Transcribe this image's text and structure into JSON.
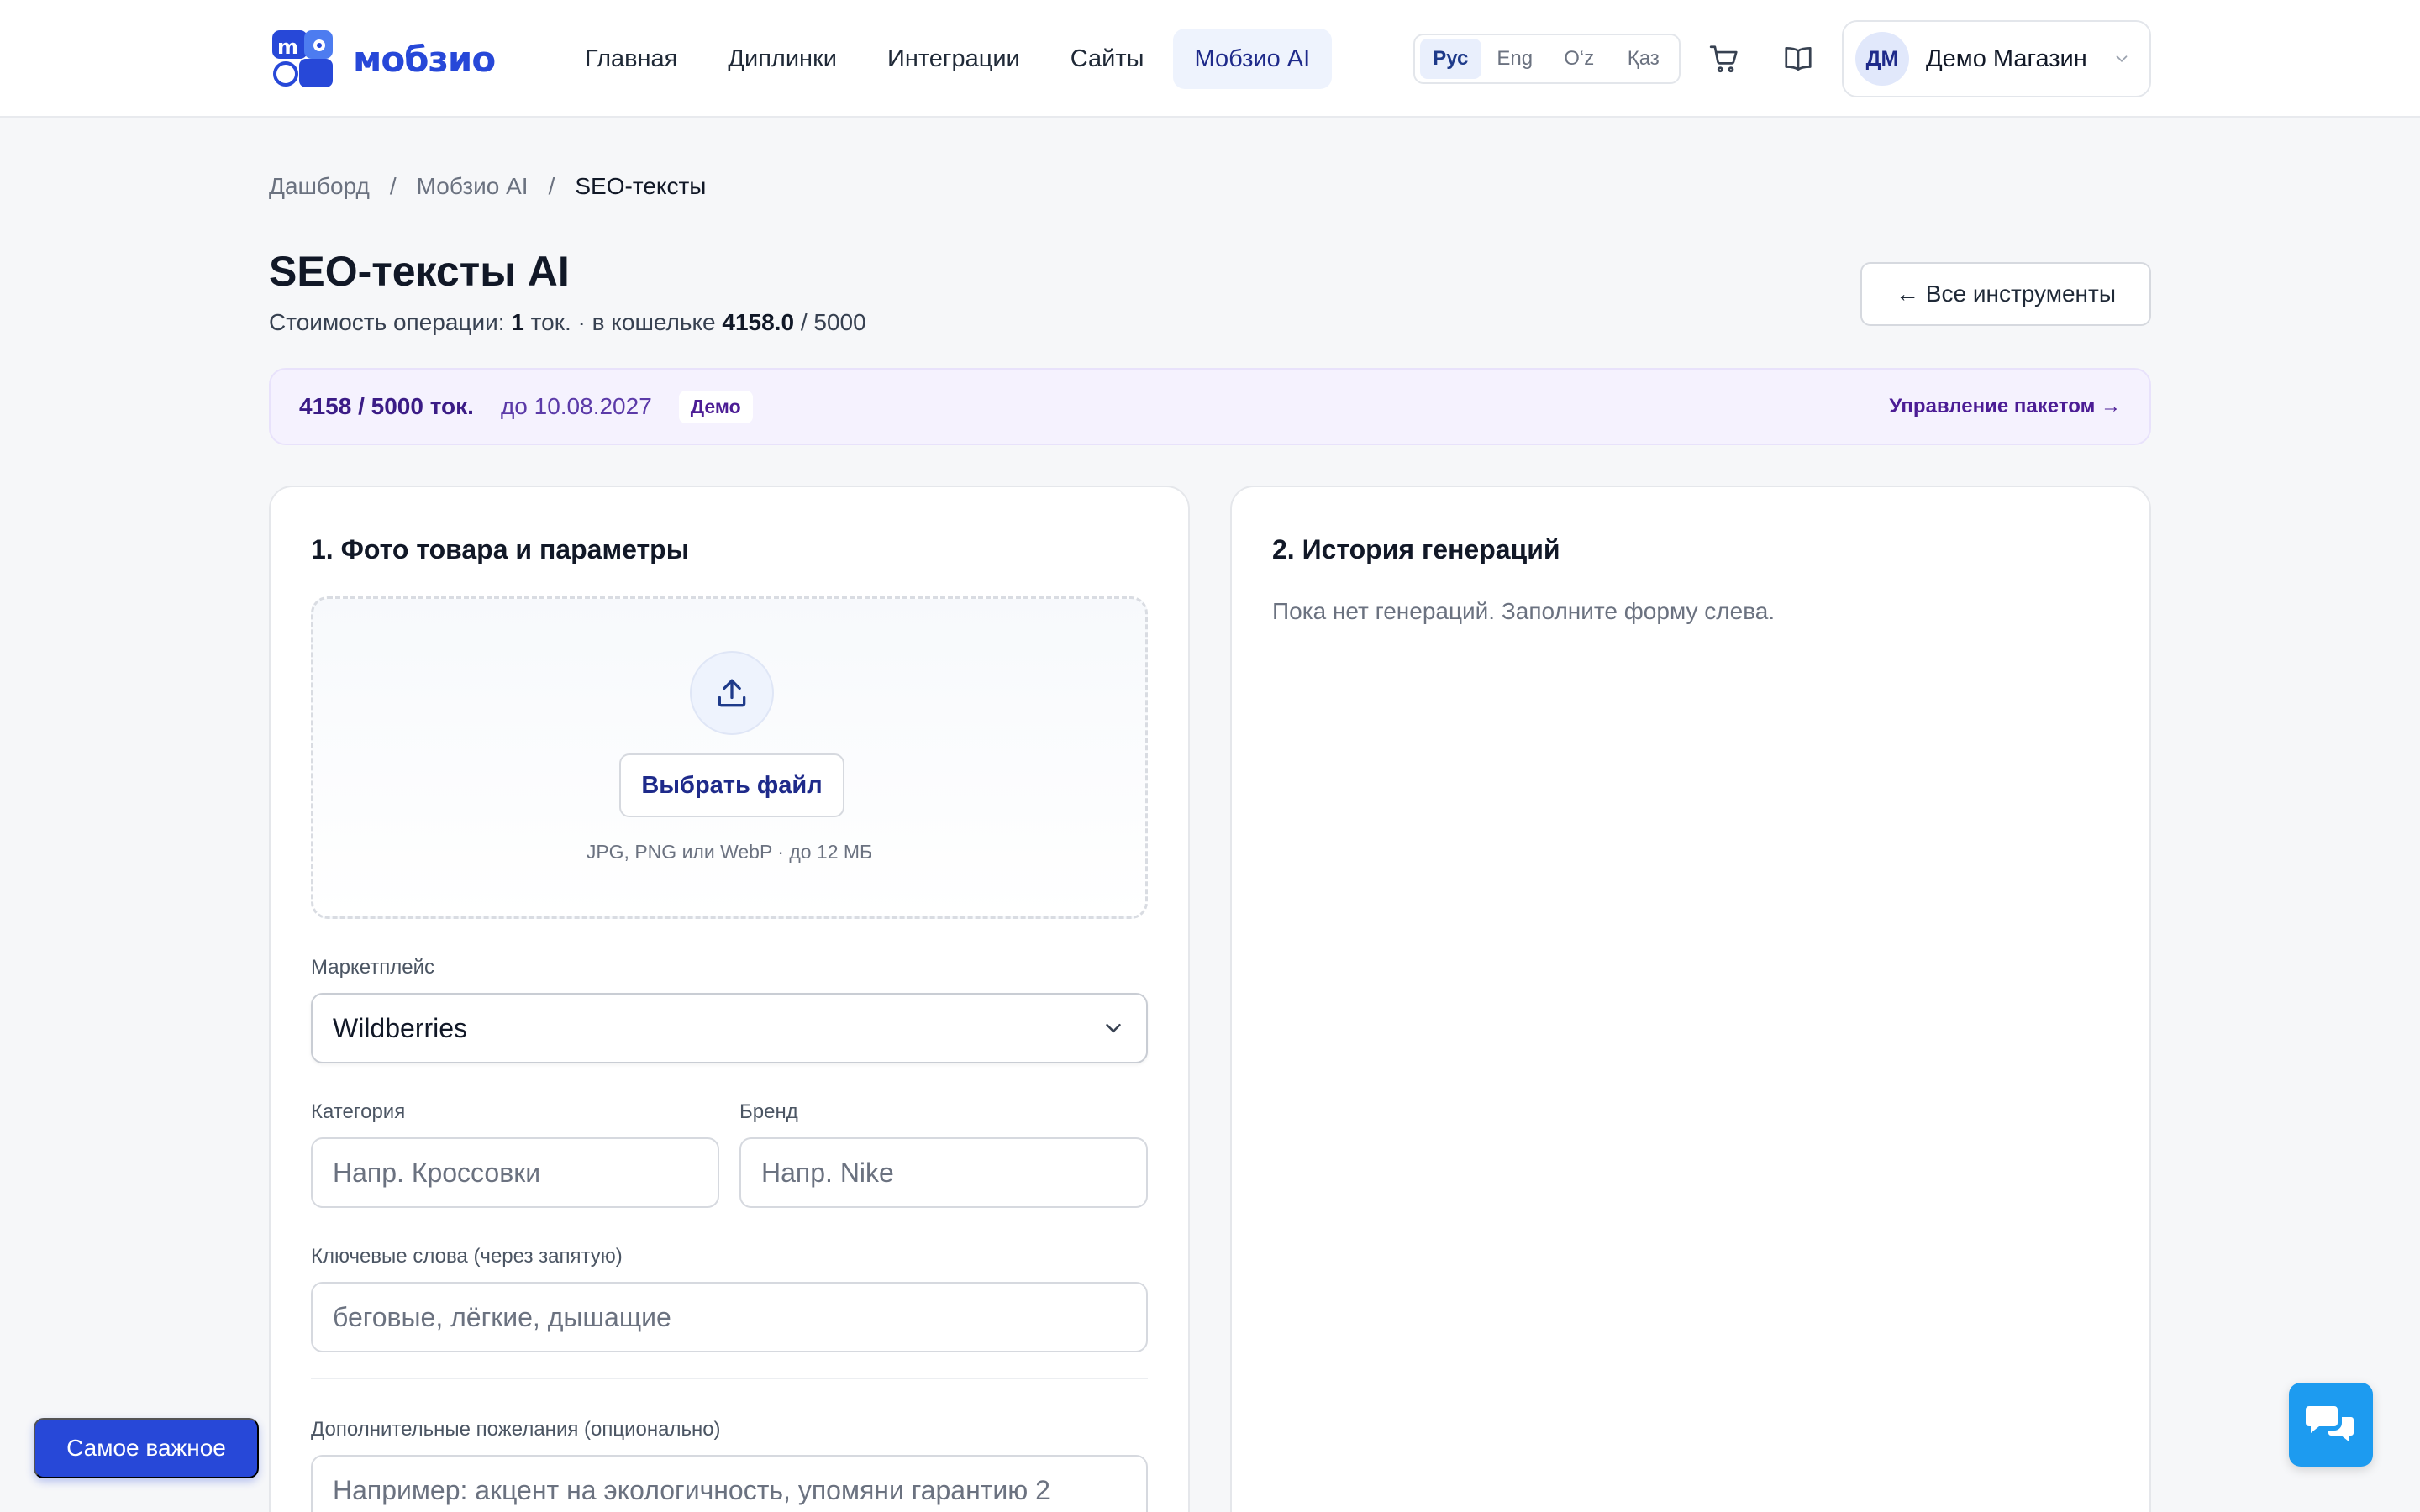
{
  "header": {
    "logo_text": "мобзио",
    "nav": [
      {
        "label": "Главная"
      },
      {
        "label": "Диплинки"
      },
      {
        "label": "Интеграции"
      },
      {
        "label": "Сайты"
      },
      {
        "label": "Мобзио AI",
        "active": true
      }
    ],
    "languages": [
      "Рус",
      "Eng",
      "O‘z",
      "Қаз"
    ],
    "active_language": "Рус",
    "icons": [
      "cart-icon",
      "book-icon",
      "chevron-down-icon"
    ],
    "user": {
      "initials": "ДМ",
      "name": "Демо Магазин"
    }
  },
  "breadcrumb": [
    "Дашборд",
    "Мобзио AI",
    "SEO-тексты"
  ],
  "page": {
    "title": "SEO-тексты AI",
    "cost_label": "Стоимость операции:",
    "cost_value": "1",
    "cost_unit": "ток. · в кошельке",
    "wallet_value": "4158.0",
    "wallet_total": "/ 5000",
    "all_tools": "← Все инструменты"
  },
  "banner": {
    "tokens": "4158 / 5000 ток.",
    "until": "до 10.08.2027",
    "badge": "Демо",
    "manage": "Управление пакетом →"
  },
  "form": {
    "title": "1. Фото товара и параметры",
    "upload": {
      "button": "Выбрать файл",
      "hint": "JPG, PNG или WebP · до 12 МБ"
    },
    "marketplace": {
      "label": "Маркетплейс",
      "value": "Wildberries"
    },
    "category": {
      "label": "Категория",
      "placeholder": "Напр. Кроссовки"
    },
    "brand": {
      "label": "Бренд",
      "placeholder": "Напр. Nike"
    },
    "keywords": {
      "label": "Ключевые слова (через запятую)",
      "placeholder": "беговые, лёгкие, дышащие"
    },
    "wishes": {
      "label": "Дополнительные пожелания (опционально)",
      "placeholder": "Например: акцент на экологичность, упомяни гарантию 2"
    }
  },
  "history": {
    "title": "2. История генераций",
    "empty": "Пока нет генераций. Заполните форму слева."
  },
  "floating": {
    "important": "Самое важное"
  },
  "colors": {
    "accent": "#2748d8",
    "chat": "#1d9bf0",
    "banner_bg": "#f5f2fe"
  }
}
